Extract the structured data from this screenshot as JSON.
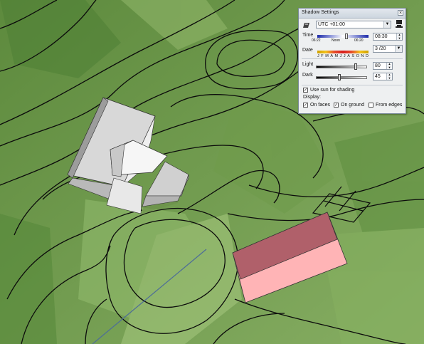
{
  "scene": {
    "terrain_color": "#6f9a4e",
    "contour_color": "#0b0b0b",
    "house_white": "#f2f2f2",
    "house_shade": "#bcbcbc",
    "red_roof": "#b05d68",
    "red_wall": "#ffb3b5",
    "axis_color": "#4d6d98"
  },
  "shadow_panel": {
    "title": "Shadow Settings",
    "close_label": "×",
    "timezone_icon": "timezone-icon",
    "timezone_value": "UTC +01:00",
    "sun_icon": "sun-display-icon",
    "time_label": "Time",
    "time_start": "06:22",
    "time_noon": "Noon",
    "time_end": "06:20",
    "time_value": "08:30",
    "time_fraction": 0.58,
    "date_label": "Date",
    "months": [
      "J",
      "F",
      "M",
      "A",
      "M",
      "J",
      "J",
      "A",
      "S",
      "O",
      "N",
      "D"
    ],
    "date_value": "3 /20",
    "light_label": "Light",
    "light_value": "80",
    "light_fraction": 0.8,
    "dark_label": "Dark",
    "dark_value": "45",
    "dark_fraction": 0.45,
    "use_sun_label": "Use sun for shading",
    "use_sun_checked": true,
    "display_label": "Display:",
    "on_faces_label": "On faces",
    "on_faces_checked": true,
    "on_ground_label": "On ground",
    "on_ground_checked": true,
    "from_edges_label": "From edges",
    "from_edges_checked": false,
    "check_mark": "✓"
  }
}
